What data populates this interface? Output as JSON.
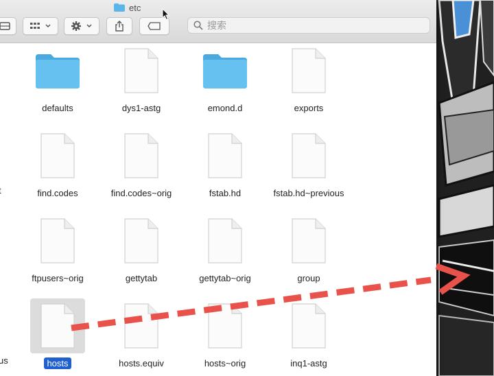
{
  "window": {
    "title": "etc",
    "search_placeholder": "搜索"
  },
  "toolbar": {
    "view_icon": "list-view-icon",
    "group_icon": "icon-grid-icon",
    "action_icon": "gear-icon",
    "share_icon": "share-icon",
    "tag_icon": "tag-icon"
  },
  "files": [
    {
      "name": "defaults",
      "kind": "folder"
    },
    {
      "name": "dys1-astg",
      "kind": "document"
    },
    {
      "name": "emond.d",
      "kind": "folder"
    },
    {
      "name": "exports",
      "kind": "document"
    },
    {
      "name": "find.codes",
      "kind": "document"
    },
    {
      "name": "find.codes~orig",
      "kind": "document"
    },
    {
      "name": "fstab.hd",
      "kind": "document"
    },
    {
      "name": "fstab.hd~previous",
      "kind": "document"
    },
    {
      "name": "ftpusers~orig",
      "kind": "document"
    },
    {
      "name": "gettytab",
      "kind": "document"
    },
    {
      "name": "gettytab~orig",
      "kind": "document"
    },
    {
      "name": "group",
      "kind": "document"
    },
    {
      "name": "hosts",
      "kind": "document",
      "selected": true
    },
    {
      "name": "hosts.equiv",
      "kind": "document"
    },
    {
      "name": "hosts~orig",
      "kind": "document"
    },
    {
      "name": "inq1-astg",
      "kind": "document"
    }
  ],
  "cut_labels": {
    "row2": "t",
    "row4": "us"
  },
  "colors": {
    "folder": "#5ab6ea",
    "selection": "#1f5fcf",
    "arrow": "#e8524a"
  }
}
